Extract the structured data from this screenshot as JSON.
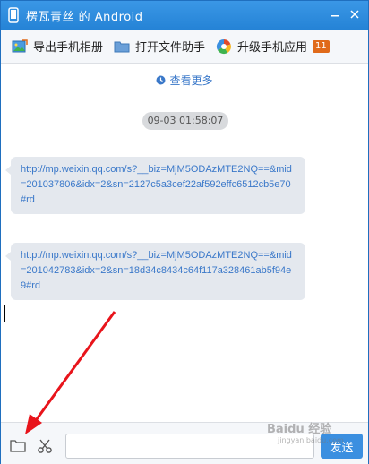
{
  "window": {
    "title": "楞瓦青丝 的 Android"
  },
  "toolbar": {
    "export_album": "导出手机相册",
    "file_assistant": "打开文件助手",
    "upgrade_apps": "升级手机应用",
    "upgrade_badge": "11"
  },
  "chat": {
    "see_more": "查看更多",
    "timestamp": "09-03 01:58:07",
    "messages": [
      {
        "text": "http://mp.weixin.qq.com/s?__biz=MjM5ODAzMTE2NQ==&mid=201037806&idx=2&sn=2127c5a3cef22af592effc6512cb5e70#rd"
      },
      {
        "text": "http://mp.weixin.qq.com/s?__biz=MjM5ODAzMTE2NQ==&mid=201042783&idx=2&sn=18d34c8434c64f117a328461ab5f94e9#rd"
      }
    ]
  },
  "input": {
    "value": "",
    "send_label": "发送"
  },
  "watermark": {
    "main": "Baidu 经验",
    "sub": "jingyan.baidu.com"
  },
  "colors": {
    "titlebar": "#2a89da",
    "link": "#3a78c9",
    "bubble": "#e4e8ee",
    "badge": "#e06a1a",
    "send_button": "#3b8fe0",
    "annotation_arrow": "#e8141b"
  },
  "icons": [
    "phone-icon",
    "minimize-icon",
    "close-icon",
    "export-album-icon",
    "folder-icon",
    "upgrade-apps-icon",
    "clock-icon",
    "scissors-icon",
    "red-arrow-annotation"
  ]
}
